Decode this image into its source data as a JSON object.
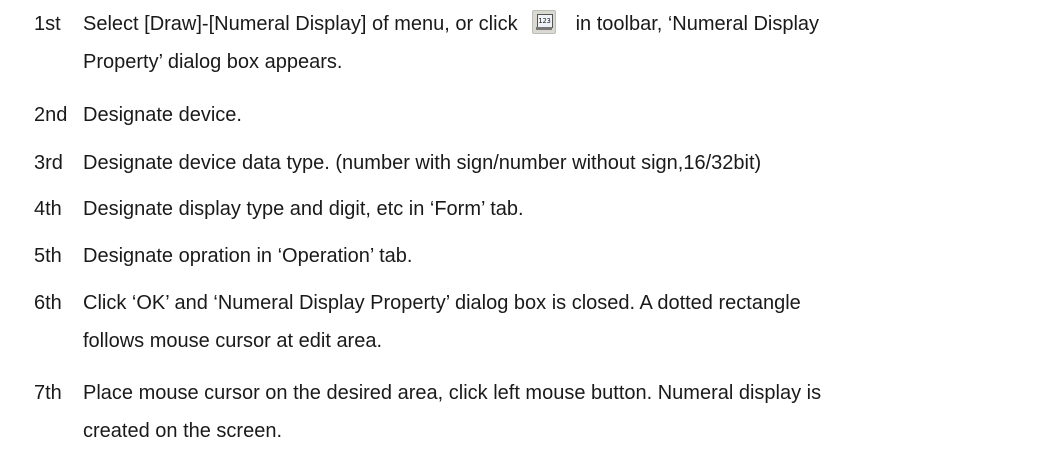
{
  "steps": [
    {
      "num": "1st",
      "line1_before_icon": "Select [Draw]-[Numeral Display] of menu, or click",
      "icon": "numeral-display-icon",
      "icon_text": "123",
      "line1_after_icon": "in toolbar, ‘Numeral Display",
      "line2": "Property’ dialog box appears."
    },
    {
      "num": "2nd",
      "line1": "Designate device."
    },
    {
      "num": "3rd",
      "line1": "Designate device data type. (number with sign/number without sign,16/32bit)"
    },
    {
      "num": "4th",
      "line1": "Designate display type and digit, etc in ‘Form’ tab."
    },
    {
      "num": "5th",
      "line1": "Designate opration in ‘Operation’ tab."
    },
    {
      "num": "6th",
      "line1": "Click ‘OK’ and ‘Numeral Display Property’ dialog box is closed. A dotted rectangle",
      "line2": "follows mouse cursor at edit area."
    },
    {
      "num": "7th",
      "line1": "Place mouse cursor on the desired area, click left mouse button. Numeral display is",
      "line2": "created on the screen."
    }
  ]
}
